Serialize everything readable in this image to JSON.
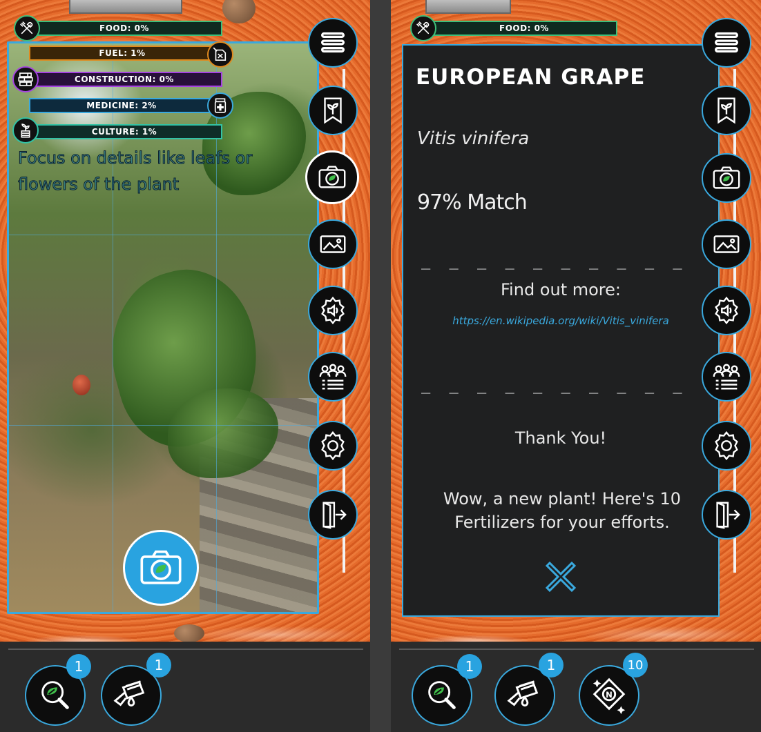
{
  "colors": {
    "accent": "#3aa9de",
    "card_bg": "#1f2021",
    "food": "#3fbf7a",
    "fuel": "#e08a1e",
    "construction": "#a544e0",
    "medicine": "#3aa9de",
    "culture": "#33c3a5"
  },
  "left": {
    "resources": {
      "food": {
        "label": "FOOD: 0%",
        "icon": "fork-knife-icon"
      },
      "fuel": {
        "label": "FUEL: 1%",
        "icon": "fuel-can-icon"
      },
      "construction": {
        "label": "CONSTRUCTION: 0%",
        "icon": "bricks-icon"
      },
      "medicine": {
        "label": "MEDICINE: 2%",
        "icon": "medicine-bottle-icon"
      },
      "culture": {
        "label": "CULTURE: 1%",
        "icon": "potted-plant-icon"
      }
    },
    "hint": "Focus on details like leafs or flowers of the plant",
    "shutter_icon": "camera-leaf-icon",
    "menu": [
      {
        "icon": "hamburger-menu-icon"
      },
      {
        "icon": "bookmark-plant-icon"
      },
      {
        "icon": "camera-leaf-icon",
        "active": true
      },
      {
        "icon": "gallery-image-icon"
      },
      {
        "icon": "sound-settings-icon"
      },
      {
        "icon": "community-icon"
      },
      {
        "icon": "gear-icon"
      },
      {
        "icon": "exit-door-icon"
      }
    ],
    "inventory": [
      {
        "icon": "magnifier-leaf-icon",
        "count": "1"
      },
      {
        "icon": "watering-can-icon",
        "count": "1"
      }
    ]
  },
  "right": {
    "resources": {
      "food": {
        "label": "FOOD: 0%",
        "icon": "fork-knife-icon"
      }
    },
    "result": {
      "title": "EUROPEAN GRAPE",
      "scientific": "Vitis vinifera",
      "match": "97% Match",
      "divider": "_ _ _ _ _ _ _ _ _ _ _ _ _ _",
      "find_out": "Find out more:",
      "link": "https://en.wikipedia.org/wiki/Vitis_vinifera",
      "thanks": "Thank You!",
      "reward": "Wow, a new plant! Here's 10 Fertilizers for your efforts."
    },
    "inventory": [
      {
        "icon": "magnifier-leaf-icon",
        "count": "1"
      },
      {
        "icon": "watering-can-icon",
        "count": "1"
      },
      {
        "icon": "fertilizer-bag-icon",
        "count": "10"
      }
    ]
  }
}
